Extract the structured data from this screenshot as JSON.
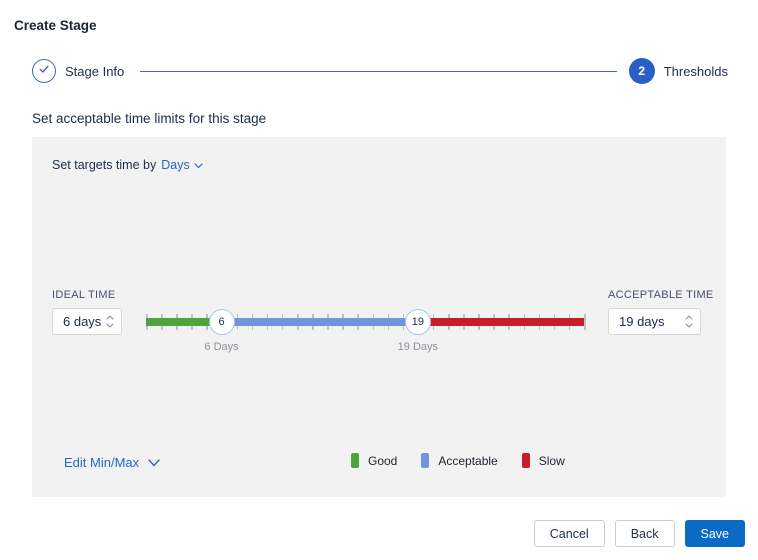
{
  "page": {
    "title": "Create Stage"
  },
  "stepper": {
    "steps": [
      {
        "label": "Stage Info",
        "state": "complete"
      },
      {
        "label": "Thresholds",
        "number": "2",
        "state": "active"
      }
    ]
  },
  "subtitle": "Set acceptable time limits for this stage",
  "panel": {
    "target_time_prefix": "Set targets time by",
    "target_time_unit": "Days",
    "ideal": {
      "label": "IDEAL TIME",
      "value": "6 days"
    },
    "acceptable": {
      "label": "ACCEPTABLE TIME",
      "value": "19 days"
    },
    "slider": {
      "min": 1,
      "max": 30,
      "handles": [
        {
          "value": 6,
          "label": "6 Days"
        },
        {
          "value": 19,
          "label": "19 Days"
        }
      ],
      "segments": [
        {
          "name": "good",
          "color": "#4ba53c"
        },
        {
          "name": "acceptable",
          "color": "#7195db"
        },
        {
          "name": "slow",
          "color": "#c3202c"
        }
      ]
    },
    "edit_minmax_label": "Edit Min/Max",
    "legend": [
      {
        "label": "Good",
        "color": "#4ba53c"
      },
      {
        "label": "Acceptable",
        "color": "#7195db"
      },
      {
        "label": "Slow",
        "color": "#c3202c"
      }
    ]
  },
  "footer": {
    "cancel_label": "Cancel",
    "back_label": "Back",
    "save_label": "Save"
  },
  "colors": {
    "accent_blue": "#2a63c8",
    "stepper_blue": "#2c5fc6",
    "save_blue": "#0a6bc4",
    "panel_bg": "#f2f2f3",
    "tick_gray": "#bfc0c5",
    "handle_border": "#a6c9ea"
  }
}
